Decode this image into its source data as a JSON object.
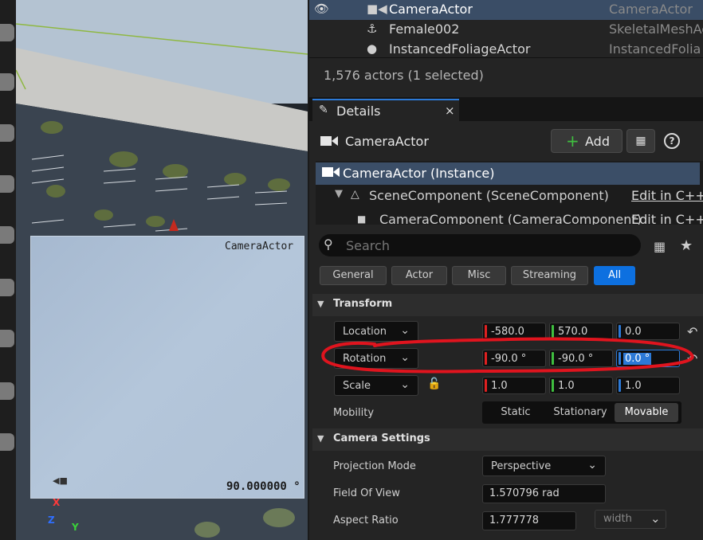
{
  "outliner": {
    "rows": [
      {
        "name": "CameraActor",
        "type": "CameraActor",
        "icon": "camera-icon",
        "selected": true
      },
      {
        "name": "Female002",
        "type": "SkeletalMeshAct",
        "icon": "skeleton-icon",
        "selected": false
      },
      {
        "name": "InstancedFoliageActor",
        "type": "InstancedFolia",
        "icon": "foliage-icon",
        "selected": false
      }
    ],
    "actor_count": "1,576 actors (1 selected)"
  },
  "details_tab": {
    "label": "Details",
    "close": "×"
  },
  "details": {
    "actor_name": "CameraActor",
    "add_label": "Add",
    "components": [
      {
        "label": "CameraActor (Instance)",
        "selected": true
      },
      {
        "label": "SceneComponent (SceneComponent)",
        "edit": "Edit in C++"
      },
      {
        "label": "CameraComponent (CameraComponent)",
        "edit": "Edit in C++"
      }
    ],
    "search_placeholder": "Search",
    "filters": [
      "General",
      "Actor",
      "Misc",
      "Streaming",
      "All"
    ],
    "active_filter": "All",
    "transform": {
      "title": "Transform",
      "location": {
        "label": "Location",
        "x": "-580.0",
        "y": "570.0",
        "z": "0.0"
      },
      "rotation": {
        "label": "Rotation",
        "x": "-90.0 °",
        "y": "-90.0 °",
        "z": "0.0 °"
      },
      "scale": {
        "label": "Scale",
        "x": "1.0",
        "y": "1.0",
        "z": "1.0"
      },
      "mobility": {
        "label": "Mobility",
        "options": [
          "Static",
          "Stationary",
          "Movable"
        ],
        "selected": "Movable"
      }
    },
    "camera_settings": {
      "title": "Camera Settings",
      "projection_mode": {
        "label": "Projection Mode",
        "value": "Perspective"
      },
      "fov": {
        "label": "Field Of View",
        "value": "1.570796 rad"
      },
      "aspect_ratio": {
        "label": "Aspect Ratio",
        "value": "1.777778",
        "constraint": "width"
      }
    }
  },
  "viewport": {
    "camera_label": "CameraActor",
    "fov_readout": "90.000000 °",
    "axis_x": "X",
    "axis_y": "Y",
    "axis_z": "Z"
  },
  "colors": {
    "selection": "#3b4e67",
    "accent_blue": "#0d70e0",
    "axis_x": "#e02020",
    "axis_y": "#3fbf3f",
    "axis_z": "#2c79d6",
    "annotation": "#e0141e"
  }
}
